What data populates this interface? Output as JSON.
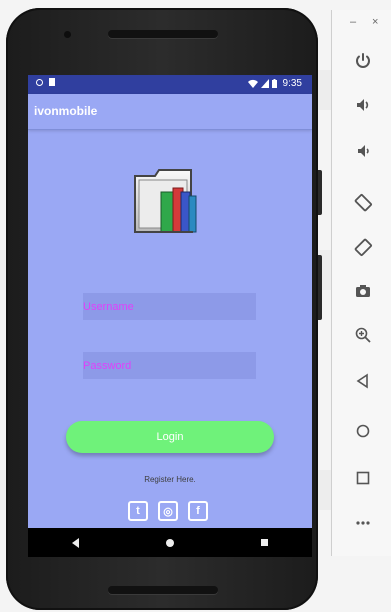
{
  "status_bar": {
    "time": "9:35"
  },
  "app": {
    "title": "ivonmobile"
  },
  "form": {
    "username_placeholder": "Username",
    "password_placeholder": "Password",
    "login_label": "Login",
    "register_label": "Register Here."
  },
  "social": {
    "twitter": "t",
    "instagram": "◎",
    "facebook": "f"
  },
  "emulator": {
    "minimize": "–",
    "close": "×",
    "tools": [
      "power-icon",
      "volume-up-icon",
      "volume-down-icon",
      "rotate-left-icon",
      "rotate-right-icon",
      "camera-icon",
      "zoom-icon",
      "back-icon",
      "home-icon",
      "overview-icon",
      "more-icon"
    ]
  },
  "colors": {
    "screen_bg": "#9aa8f4",
    "status_bar": "#303f9f",
    "login_button": "#6ff27a",
    "placeholder": "#e040fb"
  }
}
